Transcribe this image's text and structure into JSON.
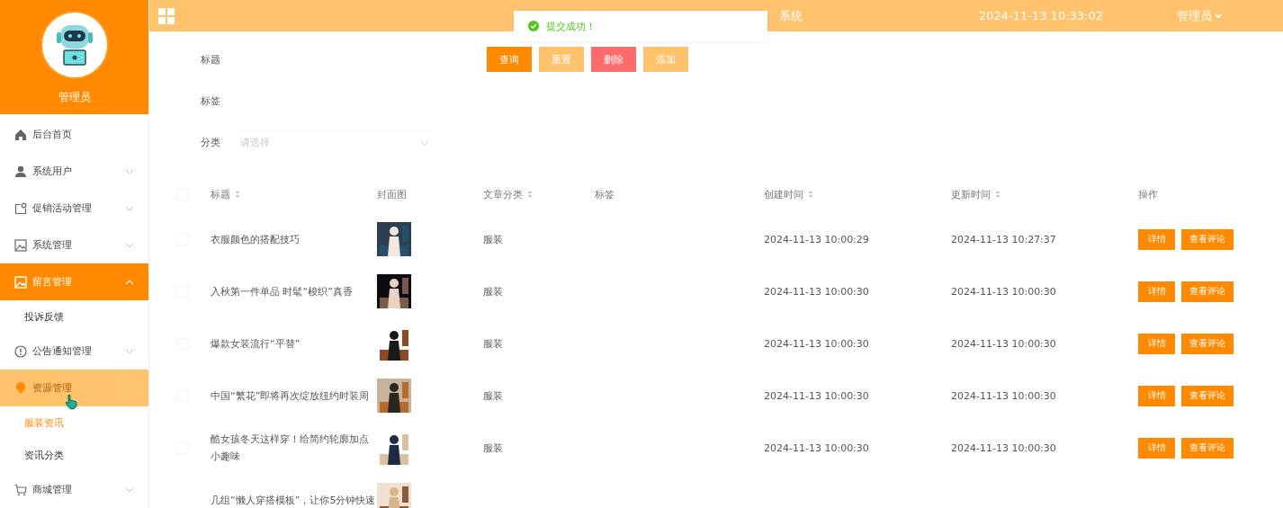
{
  "sidebar": {
    "user": "管理员",
    "items": [
      {
        "label": "后台首页",
        "kind": "link",
        "selected": false,
        "hovered": false
      },
      {
        "label": "系统用户",
        "kind": "submenu",
        "expanded": false,
        "selected": false,
        "hovered": false
      },
      {
        "label": "促销活动管理",
        "kind": "submenu",
        "expanded": false,
        "selected": false,
        "hovered": false
      },
      {
        "label": "系统管理",
        "kind": "submenu",
        "expanded": false,
        "selected": false,
        "hovered": false
      },
      {
        "label": "留言管理",
        "kind": "submenu",
        "expanded": true,
        "selected": true,
        "hovered": false,
        "children": [
          {
            "label": "投诉反馈",
            "selected": false
          }
        ]
      },
      {
        "label": "公告通知管理",
        "kind": "submenu",
        "expanded": false,
        "selected": false,
        "hovered": false
      },
      {
        "label": "资源管理",
        "kind": "submenu",
        "expanded": true,
        "selected": false,
        "hovered": true,
        "children": [
          {
            "label": "服装资讯",
            "selected": true
          },
          {
            "label": "资讯分类",
            "selected": false
          }
        ]
      },
      {
        "label": "商城管理",
        "kind": "submenu",
        "expanded": false,
        "selected": false,
        "hovered": false
      }
    ]
  },
  "header": {
    "title": "系统",
    "datetime": "2024-11-13 10:33:02",
    "user": "管理员"
  },
  "toast": {
    "kind": "success",
    "text": "提交成功！"
  },
  "filters": [
    {
      "label": "标题",
      "kind": "text"
    },
    {
      "label": "标签",
      "kind": "text"
    },
    {
      "label": "分类",
      "kind": "select",
      "placeholder": "请选择"
    }
  ],
  "buttons": [
    {
      "label": "查询",
      "kind": "primary"
    },
    {
      "label": "重置",
      "kind": "light"
    },
    {
      "label": "删除",
      "kind": "danger"
    },
    {
      "label": "添加",
      "kind": "light"
    }
  ],
  "table": {
    "select_all": {
      "checked": false
    },
    "columns": [
      {
        "label": "标题",
        "sortable": true
      },
      {
        "label": "封面图"
      },
      {
        "label": "文章分类",
        "sortable": true
      },
      {
        "label": "标签"
      },
      {
        "label": "创建时间",
        "sortable": true
      },
      {
        "label": "更新时间",
        "sortable": true
      },
      {
        "label": "操作"
      }
    ],
    "rows": [
      {
        "checked": false,
        "title": "衣服颜色的搭配技巧",
        "cover": {
          "kind": "picture"
        },
        "category": "服装",
        "created": "2024-11-13 10:00:29",
        "updated": "2024-11-13 10:27:37",
        "actions": [
          "详情",
          "查看评论"
        ]
      },
      {
        "checked": false,
        "title": "入秋第一件单品 时髦“梭织”真香",
        "cover": {
          "kind": "picture"
        },
        "category": "服装",
        "created": "2024-11-13 10:00:30",
        "updated": "2024-11-13 10:00:30",
        "actions": [
          "详情",
          "查看评论"
        ]
      },
      {
        "checked": false,
        "title": "爆款女装流行“平替”",
        "cover": {
          "kind": "picture"
        },
        "category": "服装",
        "created": "2024-11-13 10:00:30",
        "updated": "2024-11-13 10:00:30",
        "actions": [
          "详情",
          "查看评论"
        ]
      },
      {
        "checked": false,
        "title": "中国“繁花”即将再次绽放纽约时装周",
        "cover": {
          "kind": "picture"
        },
        "category": "服装",
        "created": "2024-11-13 10:00:30",
        "updated": "2024-11-13 10:00:30",
        "actions": [
          "详情",
          "查看评论"
        ]
      },
      {
        "checked": false,
        "title": "酷女孩冬天这样穿！给简约轮廓加点小趣味",
        "cover": {
          "kind": "picture"
        },
        "category": "服装",
        "created": "2024-11-13 10:00:30",
        "updated": "2024-11-13 10:00:30",
        "actions": [
          "详情",
          "查看评论"
        ]
      },
      {
        "title": "几组“懒人穿搭模板”，让你5分钟快速",
        "cover": {
          "kind": "picture"
        }
      }
    ]
  }
}
